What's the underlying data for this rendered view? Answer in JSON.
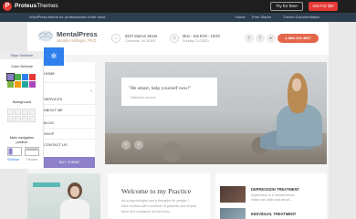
{
  "topbar": {
    "logo_letter": "P",
    "brand_bold": "Proteus",
    "brand_light": "Themes",
    "try_label": "Try for free!",
    "get_label": "Get For $0!"
  },
  "infobar": {
    "left_text": "WordPress theme for professionals of the mind",
    "right_1": "Home",
    "right_2": "Free Starter",
    "right_3": "Theme Documentation"
  },
  "header": {
    "site_name": "MentalPress",
    "tagline": "Jennifer Willinger, Ph.D",
    "address_1": "6237 Marron Street",
    "address_2": "Columbia, VA 20305",
    "hours_1": "Mon - Sat 9:00 - 18:00",
    "hours_2": "Sunday CLOSED",
    "cta_label": "1-888-123-4567"
  },
  "slider": {
    "quote": "\"Be smart, help yourself now!\"",
    "author": "- Natasha Jacobs"
  },
  "nav": {
    "items": [
      "HOME",
      "SERVICES",
      "ABOUT ME",
      "BLOG",
      "SHOP",
      "CONTACT US"
    ],
    "buy_label": "BUY THEME"
  },
  "style_switcher": {
    "header_label": "Style Switcher",
    "toggle_icon": "gear-icon",
    "color_label": "Color Scheme",
    "background_label": "Background",
    "position_label_1": "Main navigation",
    "position_label_2": "position",
    "position_opt_1": "Sidebar",
    "position_opt_2": "Header",
    "colors": [
      "#8d7fc9",
      "#4caf50",
      "#2f80ed",
      "#e53935",
      "#7cb342",
      "#f39c12",
      "#26a69a",
      "#ab47bc"
    ]
  },
  "welcome": {
    "title": "Welcome to my Practice",
    "lines": [
      "As a psychologist and a therapist for people I",
      "have worked with hundreds of patients and helped",
      "them find a balance of their lives."
    ]
  },
  "sidebar_cards": [
    {
      "title": "DEPRESSION TREATMENT",
      "line1": "Depression is a mental illness,",
      "line2": "which can strike just about..."
    },
    {
      "title": "INDIVIDUAL TREATMENT",
      "line1": "",
      "line2": ""
    }
  ],
  "colors": {
    "accent": "#e53935",
    "cta": "#e4674b",
    "switcher_blue": "#2f80ed",
    "purple": "#8d7fc9"
  }
}
